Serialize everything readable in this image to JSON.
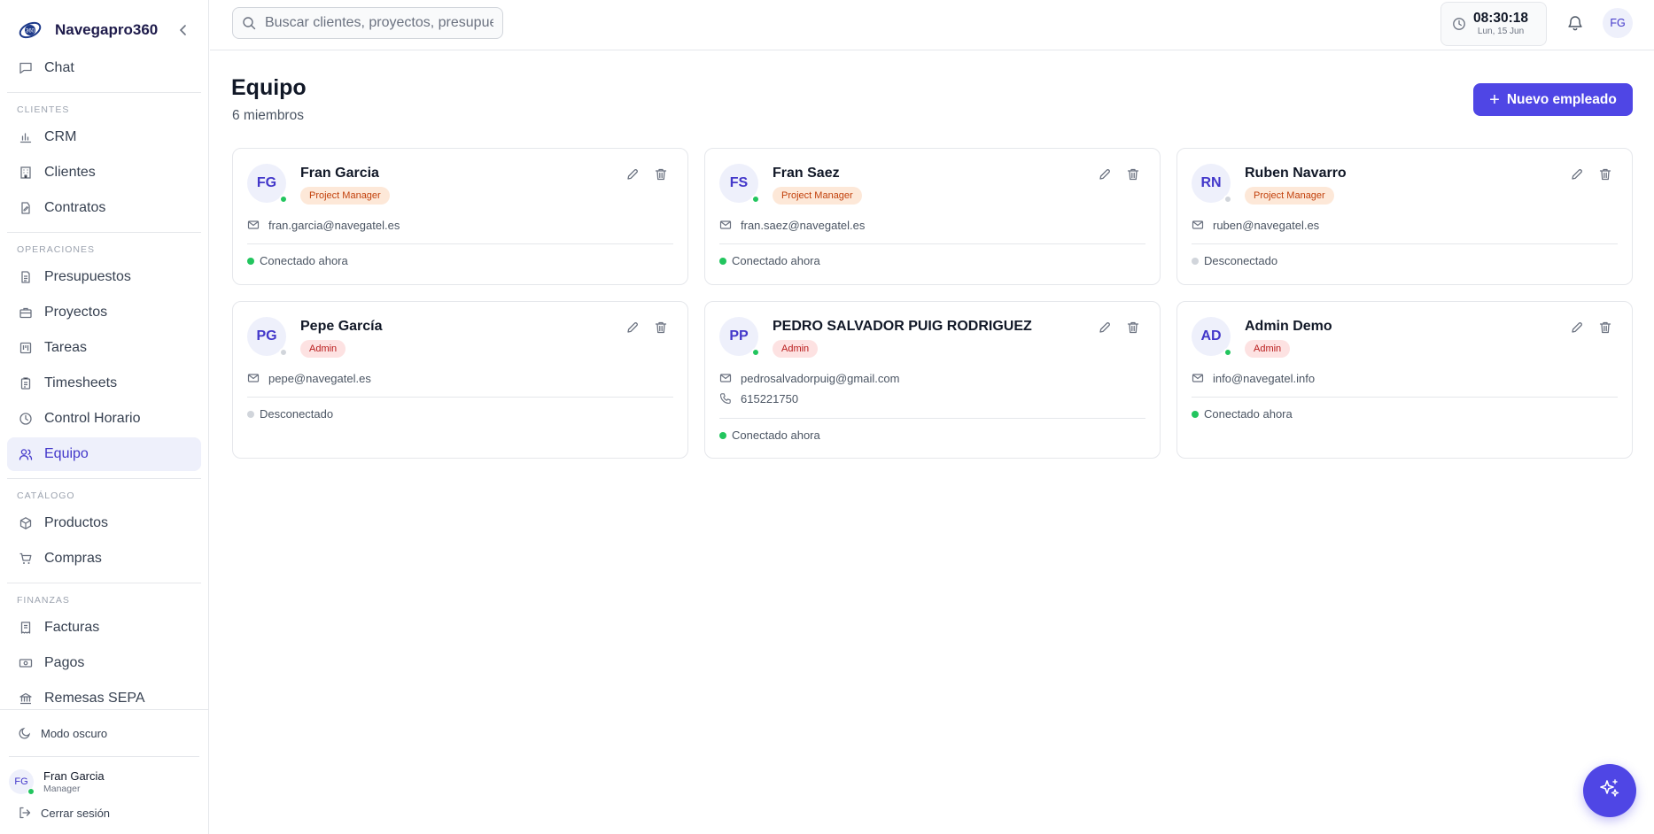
{
  "app": {
    "name": "Navegapro360"
  },
  "sidebar": {
    "top_item": {
      "label": "Chat",
      "icon": "message-square-icon"
    },
    "sections": [
      {
        "title": "CLIENTES",
        "items": [
          {
            "label": "CRM",
            "icon": "bar-chart-icon"
          },
          {
            "label": "Clientes",
            "icon": "building-icon"
          },
          {
            "label": "Contratos",
            "icon": "file-signature-icon"
          }
        ]
      },
      {
        "title": "OPERACIONES",
        "items": [
          {
            "label": "Presupuestos",
            "icon": "file-text-icon"
          },
          {
            "label": "Proyectos",
            "icon": "briefcase-icon"
          },
          {
            "label": "Tareas",
            "icon": "kanban-icon"
          },
          {
            "label": "Timesheets",
            "icon": "clipboard-icon"
          },
          {
            "label": "Control Horario",
            "icon": "clock-icon"
          },
          {
            "label": "Equipo",
            "icon": "users-icon",
            "active": true
          }
        ]
      },
      {
        "title": "CATÁLOGO",
        "items": [
          {
            "label": "Productos",
            "icon": "package-icon"
          },
          {
            "label": "Compras",
            "icon": "shopping-cart-icon"
          }
        ]
      },
      {
        "title": "FINANZAS",
        "items": [
          {
            "label": "Facturas",
            "icon": "receipt-icon"
          },
          {
            "label": "Pagos",
            "icon": "banknote-icon"
          },
          {
            "label": "Remesas SEPA",
            "icon": "landmark-icon"
          }
        ]
      }
    ],
    "dark_mode_label": "Modo oscuro",
    "user": {
      "initials": "FG",
      "name": "Fran Garcia",
      "role": "Manager"
    },
    "logout_label": "Cerrar sesión"
  },
  "topbar": {
    "search_placeholder": "Buscar clientes, proyectos, presupuestos...",
    "clock_time": "08:30:18",
    "clock_date": "Lun, 15 Jun",
    "avatar_initials": "FG"
  },
  "page": {
    "title": "Equipo",
    "subtitle": "6 miembros",
    "new_button_label": "Nuevo empleado"
  },
  "members": [
    {
      "initials": "FG",
      "name": "Fran Garcia",
      "role": "Project Manager",
      "role_type": "pm",
      "email": "fran.garcia@navegatel.es",
      "phone": null,
      "online": true,
      "status": "Conectado ahora"
    },
    {
      "initials": "FS",
      "name": "Fran Saez",
      "role": "Project Manager",
      "role_type": "pm",
      "email": "fran.saez@navegatel.es",
      "phone": null,
      "online": true,
      "status": "Conectado ahora"
    },
    {
      "initials": "RN",
      "name": "Ruben Navarro",
      "role": "Project Manager",
      "role_type": "pm",
      "email": "ruben@navegatel.es",
      "phone": null,
      "online": false,
      "status": "Desconectado"
    },
    {
      "initials": "PG",
      "name": "Pepe García",
      "role": "Admin",
      "role_type": "admin",
      "email": "pepe@navegatel.es",
      "phone": null,
      "online": false,
      "status": "Desconectado"
    },
    {
      "initials": "PP",
      "name": "PEDRO SALVADOR PUIG RODRIGUEZ",
      "role": "Admin",
      "role_type": "admin",
      "email": "pedrosalvadorpuig@gmail.com",
      "phone": "615221750",
      "online": true,
      "status": "Conectado ahora"
    },
    {
      "initials": "AD",
      "name": "Admin Demo",
      "role": "Admin",
      "role_type": "admin",
      "email": "info@navegatel.info",
      "phone": null,
      "online": true,
      "status": "Conectado ahora"
    }
  ],
  "colors": {
    "accent": "#4f46e5",
    "online": "#22c55e",
    "offline": "#d1d5db"
  }
}
